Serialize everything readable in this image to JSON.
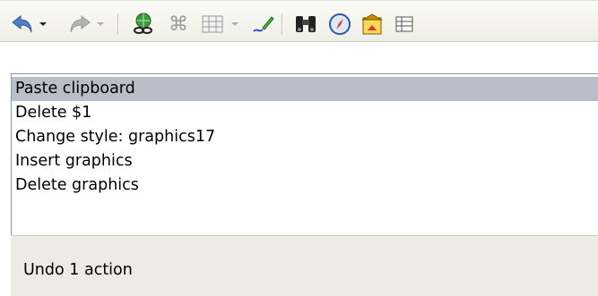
{
  "toolbar": {
    "icons": [
      "undo-icon",
      "redo-icon",
      "hyperlink-icon",
      "navigator-icon",
      "table-icon",
      "draw-functions-icon",
      "find-replace-icon",
      "navigator-compass-icon",
      "gallery-icon",
      "data-sources-icon"
    ]
  },
  "undo_list": {
    "items": [
      {
        "label": "Paste clipboard",
        "selected": true
      },
      {
        "label": "Delete $1",
        "selected": false
      },
      {
        "label": "Change style: graphics17",
        "selected": false
      },
      {
        "label": "Insert graphics",
        "selected": false
      },
      {
        "label": "Delete graphics",
        "selected": false
      }
    ]
  },
  "status": {
    "text": "Undo 1 action"
  }
}
